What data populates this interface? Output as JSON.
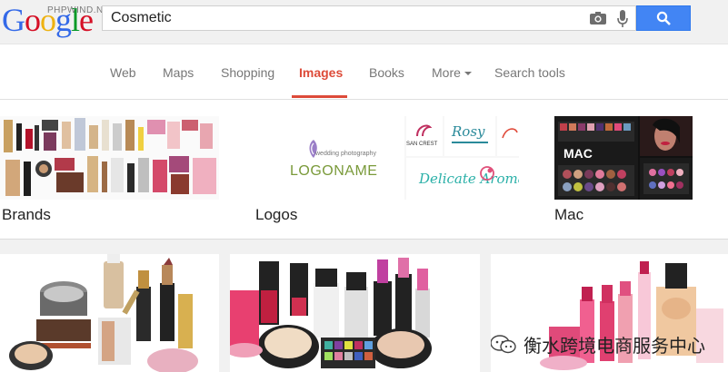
{
  "header": {
    "logo_letters": [
      "G",
      "o",
      "o",
      "g",
      "l",
      "e"
    ],
    "logo_colors": [
      "#3369e8",
      "#d50f25",
      "#eeb211",
      "#3369e8",
      "#009925",
      "#d50f25"
    ],
    "watermark": "PHPWIND.NET",
    "search_value": "Cosmetic",
    "search_button_color": "#4285f4"
  },
  "tabs": [
    {
      "label": "Web"
    },
    {
      "label": "Maps"
    },
    {
      "label": "Shopping"
    },
    {
      "label": "Images"
    },
    {
      "label": "Books"
    },
    {
      "label": "More"
    },
    {
      "label": "Search tools"
    }
  ],
  "active_tab": "Images",
  "active_color": "#dd4b39",
  "categories": [
    {
      "label": "Brands"
    },
    {
      "label": "Logos"
    },
    {
      "label": "Mac"
    }
  ],
  "logos_thumbs": {
    "main": "LOGONAME",
    "main_sub": "wedding photography",
    "thumb1": "SAN CREST",
    "thumb2": "Rosy",
    "thumb3": "Delicate Aroma"
  },
  "footer_watermark": "衡水跨境电商服务中心",
  "icons": [
    "camera-icon",
    "microphone-icon",
    "search-icon",
    "wechat-icon"
  ]
}
